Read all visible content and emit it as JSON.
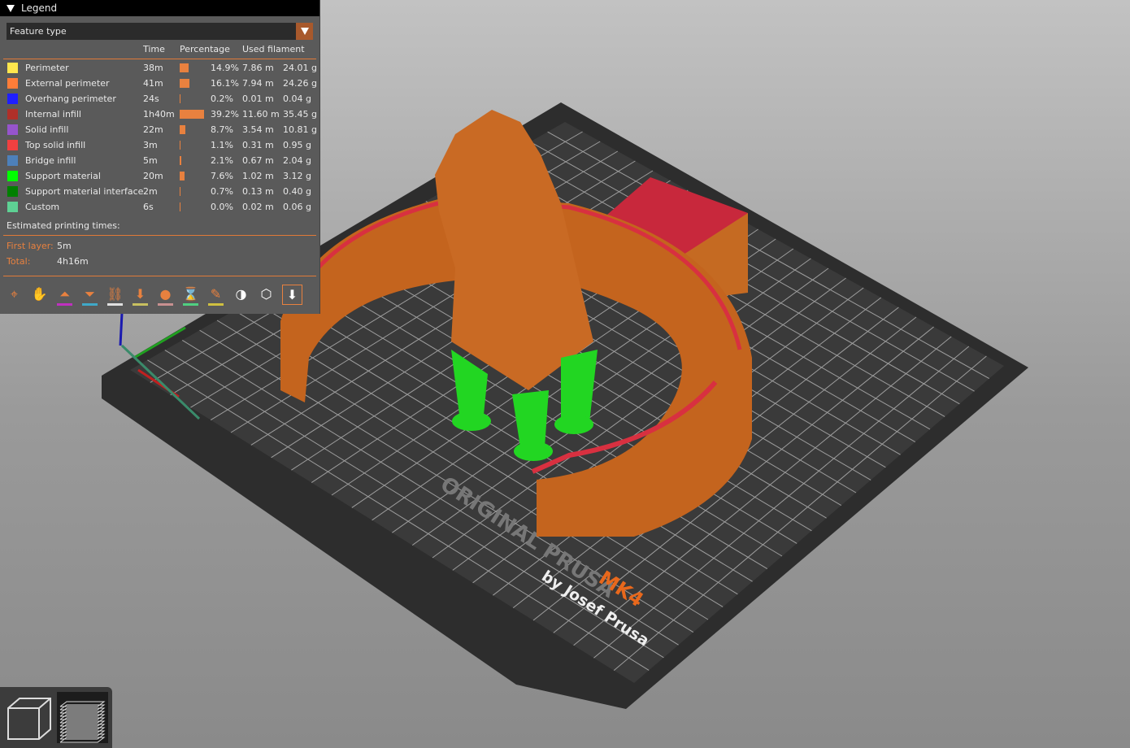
{
  "legend": {
    "title": "Legend",
    "view_type": "Feature type",
    "columns": {
      "time": "Time",
      "percentage": "Percentage",
      "used_filament": "Used filament"
    },
    "rows": [
      {
        "name": "Perimeter",
        "color": "#ffe64d",
        "time": "38m",
        "percent": "14.9%",
        "pct": 14.9,
        "length": "7.86 m",
        "weight": "24.01 g"
      },
      {
        "name": "External perimeter",
        "color": "#ff7d38",
        "time": "41m",
        "percent": "16.1%",
        "pct": 16.1,
        "length": "7.94 m",
        "weight": "24.26 g"
      },
      {
        "name": "Overhang perimeter",
        "color": "#1f1fff",
        "time": "24s",
        "percent": "0.2%",
        "pct": 0.2,
        "length": "0.01 m",
        "weight": "0.04 g"
      },
      {
        "name": "Internal infill",
        "color": "#b03029",
        "time": "1h40m",
        "percent": "39.2%",
        "pct": 39.2,
        "length": "11.60 m",
        "weight": "35.45 g"
      },
      {
        "name": "Solid infill",
        "color": "#9654cc",
        "time": "22m",
        "percent": "8.7%",
        "pct": 8.7,
        "length": "3.54 m",
        "weight": "10.81 g"
      },
      {
        "name": "Top solid infill",
        "color": "#f04040",
        "time": "3m",
        "percent": "1.1%",
        "pct": 1.1,
        "length": "0.31 m",
        "weight": "0.95 g"
      },
      {
        "name": "Bridge infill",
        "color": "#4d80ba",
        "time": "5m",
        "percent": "2.1%",
        "pct": 2.1,
        "length": "0.67 m",
        "weight": "2.04 g"
      },
      {
        "name": "Support material",
        "color": "#00ff00",
        "time": "20m",
        "percent": "7.6%",
        "pct": 7.6,
        "length": "1.02 m",
        "weight": "3.12 g"
      },
      {
        "name": "Support material interface",
        "color": "#008000",
        "time": "2m",
        "percent": "0.7%",
        "pct": 0.7,
        "length": "0.13 m",
        "weight": "0.40 g"
      },
      {
        "name": "Custom",
        "color": "#5ed194",
        "time": "6s",
        "percent": "0.0%",
        "pct": 0.0,
        "length": "0.02 m",
        "weight": "0.06 g"
      }
    ],
    "estimated_title": "Estimated printing times:",
    "first_layer_label": "First layer:",
    "first_layer": "5m",
    "total_label": "Total:",
    "total": "4h16m"
  },
  "toolbar": [
    {
      "name": "travel-icon",
      "glyph": "⌖",
      "ul": ""
    },
    {
      "name": "wipe-icon",
      "glyph": "✋",
      "ul": ""
    },
    {
      "name": "retractions-icon",
      "glyph": "⏶",
      "ul": "#c030c0"
    },
    {
      "name": "deretractions-icon",
      "glyph": "⏷",
      "ul": "#3fa8c8"
    },
    {
      "name": "seams-icon",
      "glyph": "⛓",
      "ul": "#e0e0e0"
    },
    {
      "name": "tool-changes-icon",
      "glyph": "⬇",
      "ul": "#c8c060"
    },
    {
      "name": "color-changes-icon",
      "glyph": "●",
      "ul": "#c89090"
    },
    {
      "name": "pause-prints-icon",
      "glyph": "⌛",
      "ul": "#50d080"
    },
    {
      "name": "custom-gcodes-icon",
      "glyph": "✎",
      "ul": "#d0c040"
    },
    {
      "name": "center-of-gravity-icon",
      "glyph": "◑",
      "ul": ""
    },
    {
      "name": "shells-icon",
      "glyph": "⬡",
      "ul": ""
    },
    {
      "name": "tool-marker-icon",
      "glyph": "⬇",
      "ul": ""
    }
  ],
  "bed": {
    "brand": "ORIGINAL PRUSA",
    "model": "MK4",
    "subtitle": "by Josef Prusa"
  }
}
